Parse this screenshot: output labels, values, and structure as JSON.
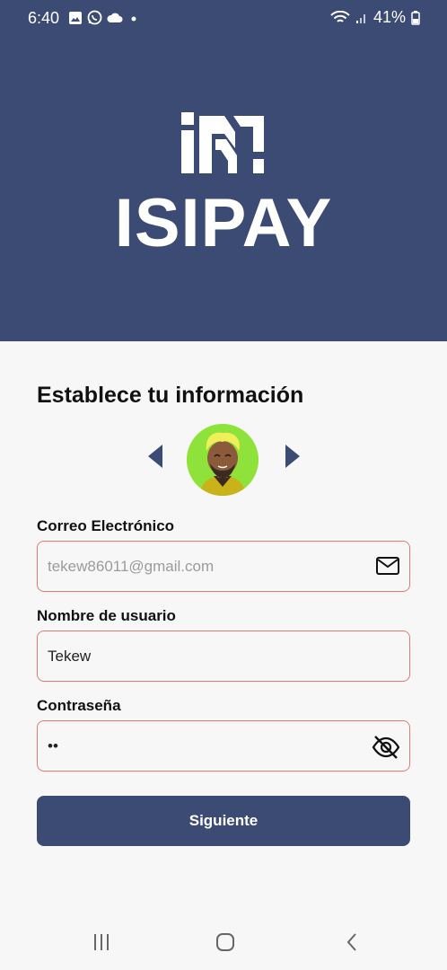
{
  "status_bar": {
    "time": "6:40",
    "battery": "41%"
  },
  "brand": {
    "name": "ISIPAY"
  },
  "form": {
    "title": "Establece tu información",
    "email": {
      "label": "Correo Electrónico",
      "placeholder": "tekew86011@gmail.com"
    },
    "username": {
      "label": "Nombre de usuario",
      "value": "Tekew"
    },
    "password": {
      "label": "Contraseña",
      "value": "••"
    },
    "submit_label": "Siguiente"
  },
  "colors": {
    "primary": "#3c4b74",
    "field_border": "#e07a72",
    "avatar_bg": "#8fe23a"
  },
  "icons": [
    "mail-icon",
    "eye-off-icon",
    "chevron-left-icon",
    "chevron-right-icon"
  ]
}
